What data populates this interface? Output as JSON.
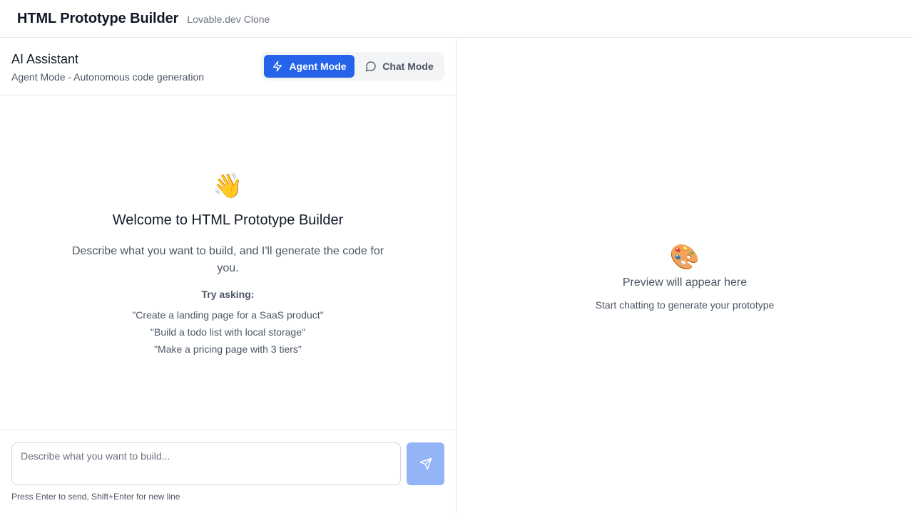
{
  "header": {
    "title": "HTML Prototype Builder",
    "subtitle": "Lovable.dev Clone"
  },
  "assistant": {
    "title": "AI Assistant",
    "subtitle": "Agent Mode - Autonomous code generation",
    "modes": {
      "agent_label": "Agent Mode",
      "chat_label": "Chat Mode",
      "active": "Agent Mode"
    }
  },
  "welcome": {
    "emoji": "👋",
    "title": "Welcome to HTML Prototype Builder",
    "description": "Describe what you want to build, and I'll generate the code for you.",
    "try_label": "Try asking:",
    "examples": [
      "\"Create a landing page for a SaaS product\"",
      "\"Build a todo list with local storage\"",
      "\"Make a pricing page with 3 tiers\""
    ]
  },
  "input": {
    "placeholder": "Describe what you want to build...",
    "value": "",
    "send_icon": "send-icon",
    "hint": "Press Enter to send, Shift+Enter for new line"
  },
  "preview": {
    "emoji": "🎨",
    "title": "Preview will appear here",
    "subtitle": "Start chatting to generate your prototype"
  },
  "colors": {
    "accent": "#2563eb",
    "send_disabled": "#93b4f6",
    "border": "#e5e7eb",
    "muted_text": "#4b5563"
  }
}
